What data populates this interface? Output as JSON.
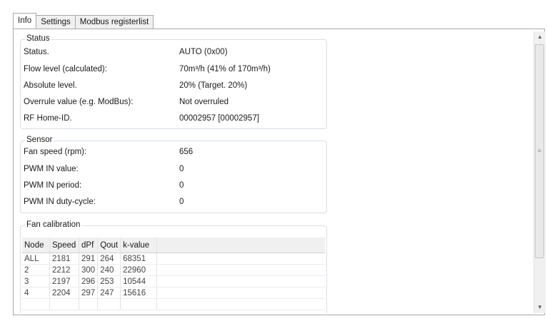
{
  "tabs": [
    {
      "label": "Info",
      "active": true
    },
    {
      "label": "Settings",
      "active": false
    },
    {
      "label": "Modbus registerlist",
      "active": false
    }
  ],
  "status": {
    "title": "Status",
    "rows": [
      {
        "label": "Status.",
        "value": "AUTO (0x00)"
      },
      {
        "label": "Flow level (calculated):",
        "value": "70m³/h (41% of 170m³/h)"
      },
      {
        "label": "Absolute level.",
        "value": "20% (Target. 20%)"
      },
      {
        "label": "Overrule value (e.g. ModBus):",
        "value": "Not overruled"
      },
      {
        "label": "RF Home-ID.",
        "value": "00002957 [00002957]"
      }
    ]
  },
  "sensor": {
    "title": "Sensor",
    "rows": [
      {
        "label": "Fan speed (rpm):",
        "value": "656"
      },
      {
        "label": "PWM IN value:",
        "value": "0"
      },
      {
        "label": "PWM IN period:",
        "value": "0"
      },
      {
        "label": "PWM IN duty-cycle:",
        "value": "0"
      }
    ]
  },
  "calibration": {
    "title": "Fan calibration",
    "columns": [
      "Node",
      "Speed",
      "dPf",
      "Qout",
      "k-value"
    ],
    "rows": [
      [
        "ALL",
        "2181",
        "291",
        "264",
        "68351"
      ],
      [
        "2",
        "2212",
        "300",
        "240",
        "22960"
      ],
      [
        "3",
        "2197",
        "296",
        "253",
        "10544"
      ],
      [
        "4",
        "2204",
        "297",
        "247",
        "15616"
      ]
    ]
  },
  "scrollbar": {
    "up_icon": "▲",
    "down_icon": "▼"
  }
}
